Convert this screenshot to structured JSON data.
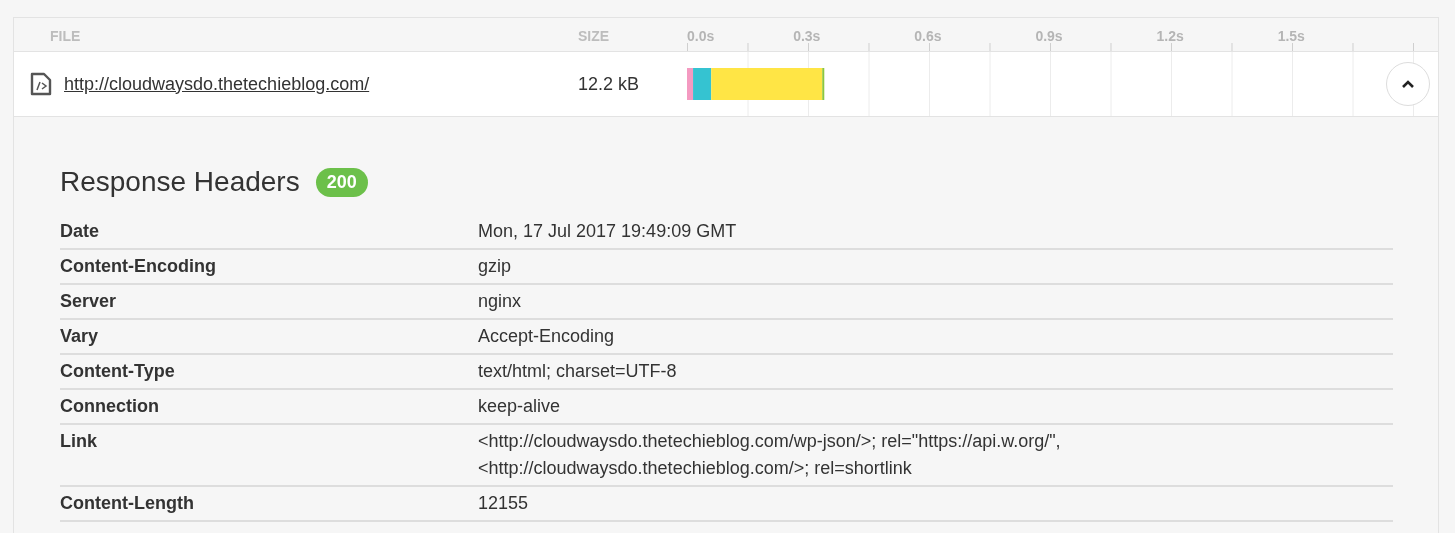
{
  "columns": [
    "FILE",
    "SIZE"
  ],
  "request": {
    "url": "http://cloudwaysdo.thetechieblog.com/",
    "size": "12.2 kB",
    "expanded": true
  },
  "timeline": {
    "chart_data": {
      "type": "bar",
      "orientation": "horizontal",
      "stacked": true,
      "grid": true,
      "xlim": [
        0,
        1.86
      ],
      "xticks": [
        {
          "value": 0,
          "label": "0.0s"
        },
        {
          "value": 0.3,
          "label": "0.3s"
        },
        {
          "value": 0.6,
          "label": "0.6s"
        },
        {
          "value": 0.9,
          "label": "0.9s"
        },
        {
          "value": 1.2,
          "label": "1.2s"
        },
        {
          "value": 1.5,
          "label": "1.5s"
        }
      ],
      "series": [
        {
          "color": "#f49ac1",
          "values": [
            0.015
          ]
        },
        {
          "color": "#35c3d1",
          "values": [
            0.045
          ]
        },
        {
          "color": "#ffe545",
          "values": [
            0.275
          ]
        },
        {
          "color": "#8cc63f",
          "values": [
            0.005
          ]
        }
      ]
    }
  },
  "details": {
    "title": "Response Headers",
    "status": "200",
    "headers": [
      {
        "name": "Date",
        "value": "Mon, 17 Jul 2017 19:49:09 GMT"
      },
      {
        "name": "Content-Encoding",
        "value": "gzip"
      },
      {
        "name": "Server",
        "value": "nginx"
      },
      {
        "name": "Vary",
        "value": "Accept-Encoding"
      },
      {
        "name": "Content-Type",
        "value": "text/html; charset=UTF-8"
      },
      {
        "name": "Connection",
        "value": "keep-alive"
      },
      {
        "name": "Link",
        "value": "<http://cloudwaysdo.thetechieblog.com/wp-json/>; rel=\"https://api.w.org/\",\n<http://cloudwaysdo.thetechieblog.com/>; rel=shortlink"
      },
      {
        "name": "Content-Length",
        "value": "12155"
      }
    ]
  }
}
